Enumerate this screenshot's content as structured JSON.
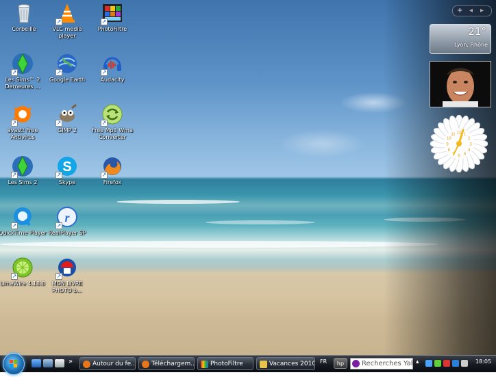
{
  "desktop": {
    "icons": [
      {
        "label": "Corbeille",
        "icon": "recycle-bin-icon"
      },
      {
        "label": "VLC media player",
        "icon": "vlc-cone-icon"
      },
      {
        "label": "PhotoFiltre",
        "icon": "photofiltre-icon"
      },
      {
        "label": "Les Sims™ 2 Demeures ...",
        "icon": "sims-plumbob-icon"
      },
      {
        "label": "Google Earth",
        "icon": "google-earth-icon"
      },
      {
        "label": "Audacity",
        "icon": "audacity-headphones-icon"
      },
      {
        "label": "avast! Free Antivirus",
        "icon": "avast-icon"
      },
      {
        "label": "GIMP 2",
        "icon": "gimp-icon"
      },
      {
        "label": "Free Mp3 Wma Converter",
        "icon": "converter-icon"
      },
      {
        "label": "Les Sims 2",
        "icon": "sims-plumbob-icon"
      },
      {
        "label": "Skype",
        "icon": "skype-icon"
      },
      {
        "label": "Firefox",
        "icon": "firefox-icon"
      },
      {
        "label": "QuickTime Player",
        "icon": "quicktime-icon"
      },
      {
        "label": "RealPlayer SP",
        "icon": "realplayer-icon"
      },
      {
        "label": "LimeWire 4.18.8",
        "icon": "limewire-icon"
      },
      {
        "label": "MON LIVRE PHOTO b...",
        "icon": "photo-book-icon"
      }
    ]
  },
  "sidebar": {
    "controls": {
      "add": "+",
      "prev": "◂",
      "next": "▸"
    },
    "weather": {
      "temperature": "21°",
      "city": "Lyon, Rhône"
    },
    "clock": {
      "numerals": [
        "12",
        "1",
        "2",
        "3",
        "4",
        "5",
        "6",
        "7",
        "8",
        "9",
        "10",
        "11"
      ]
    }
  },
  "taskbar": {
    "chevron": "»",
    "buttons": [
      {
        "label": "Autour du fe...",
        "color": "#e8751a"
      },
      {
        "label": "Téléchargem...",
        "color": "#e8751a"
      },
      {
        "label": "PhotoFiltre",
        "color": "#3b8a2e"
      },
      {
        "label": "Vacances 2010",
        "color": "#e8c54a"
      }
    ],
    "language": "FR",
    "hp_label": "hp",
    "search_value": "Recherches Yahoo",
    "time": "18:05"
  }
}
